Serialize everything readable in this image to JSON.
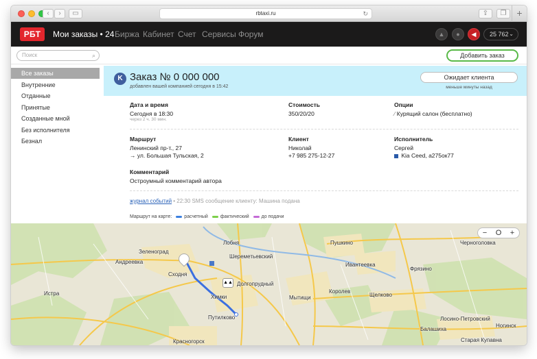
{
  "browser": {
    "url": "rbtaxi.ru"
  },
  "nav": {
    "logo": "РБТ",
    "items": [
      "Мои заказы • 24",
      "Биржа",
      "Кабинет",
      "Счет",
      "Сервисы",
      "Форум"
    ],
    "balance": "25 762",
    "accent": "#e3262d"
  },
  "search": {
    "placeholder": "Поиск"
  },
  "add_order_label": "Добавить заказ",
  "sidebar": {
    "items": [
      "Все заказы",
      "Внутренние",
      "Отданные",
      "Принятые",
      "Созданные мной",
      "Без исполнителя",
      "Безнал"
    ],
    "selected": "Все заказы"
  },
  "order": {
    "badge": "K",
    "title": "Заказ № 0 000 000",
    "subtitle": "добавлен вашей компанией сегодня в 15:42",
    "status_label": "Ожидает клиента",
    "status_note": "меньше минуты назад"
  },
  "details": {
    "datetime_label": "Дата и время",
    "datetime_value": "Сегодня в 18:30",
    "datetime_hint": "через 2 ч. 30 мин.",
    "cost_label": "Стоимость",
    "cost_value": "350/20/20",
    "options_label": "Опции",
    "options_value": "Курящий салон (бесплатно)",
    "route_label": "Маршрут",
    "route_from": "Ленинский пр-т., 27",
    "route_to": "→ ул. Большая Тульская, 2",
    "client_label": "Клиент",
    "client_name": "Николай",
    "client_phone": "+7 985 275-12-27",
    "driver_label": "Исполнитель",
    "driver_name": "Сергей",
    "driver_car": "Kia Ceed, а275ок77",
    "comment_label": "Комментарий",
    "comment_value": "Остроумный комментарий автора"
  },
  "log": {
    "link": "журнал событий",
    "entry": " • 22:30 SMS сообщение клиенту: Машина подана"
  },
  "legend": {
    "label": "Маршрут на карте:",
    "items": [
      {
        "name": "расчетный",
        "color": "#3b7fe0"
      },
      {
        "name": "фактический",
        "color": "#7ccf4a"
      },
      {
        "name": "до подачи",
        "color": "#c46bd6"
      }
    ]
  },
  "map": {
    "places": [
      "Андреевка",
      "Зеленоград",
      "Лобня",
      "Пушкино",
      "Ивантеевка",
      "Щелково",
      "Черноголовка",
      "Фрязино",
      "Мытищи",
      "Королев",
      "Долгопрудный",
      "Химки",
      "Сходня",
      "Истра",
      "Путилково",
      "Балашиха",
      "Лосино-Петровский",
      "Ногинск",
      "Красногорск",
      "Старая Купавна",
      "Шереметьевский"
    ],
    "zoom_buttons": [
      "−",
      "O",
      "+"
    ]
  }
}
